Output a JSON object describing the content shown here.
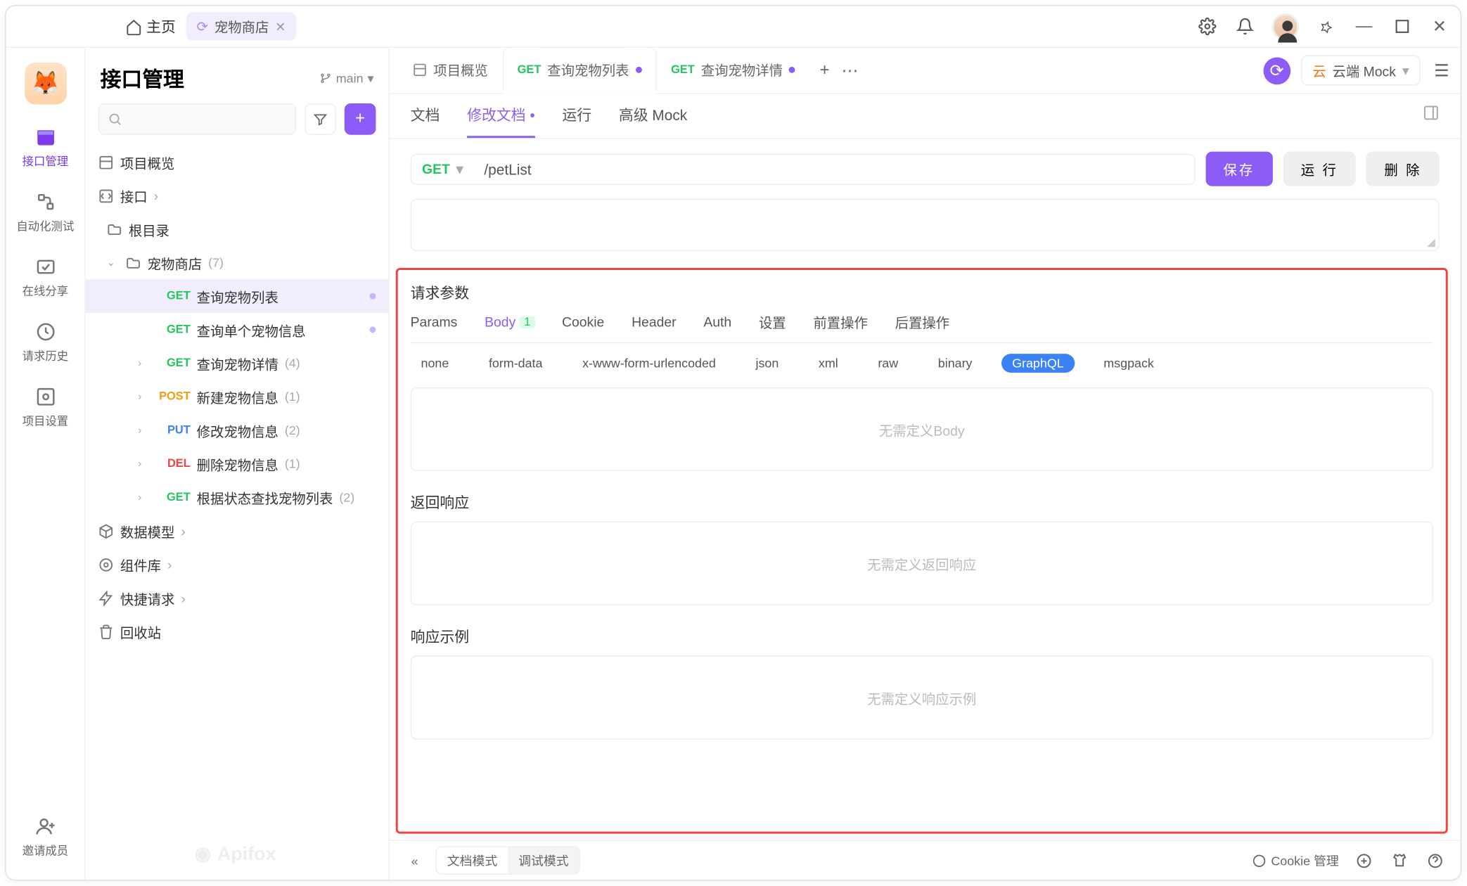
{
  "top": {
    "home": "主页",
    "tab_name": "宠物商店"
  },
  "rail": [
    {
      "label": "接口管理",
      "active": true
    },
    {
      "label": "自动化测试"
    },
    {
      "label": "在线分享"
    },
    {
      "label": "请求历史"
    },
    {
      "label": "项目设置"
    },
    {
      "label": "邀请成员"
    }
  ],
  "sidebar": {
    "title": "接口管理",
    "branch": "main",
    "overview": "项目概览",
    "api_group": "接口",
    "root_folder": "根目录",
    "folder_name": "宠物商店",
    "folder_count": "(7)",
    "endpoints": [
      {
        "method": "GET",
        "name": "查询宠物列表",
        "active": true,
        "dot": true
      },
      {
        "method": "GET",
        "name": "查询单个宠物信息",
        "dot": true
      },
      {
        "method": "GET",
        "name": "查询宠物详情",
        "count": "(4)",
        "expand": true
      },
      {
        "method": "POST",
        "name": "新建宠物信息",
        "count": "(1)",
        "expand": true
      },
      {
        "method": "PUT",
        "name": "修改宠物信息",
        "count": "(2)",
        "expand": true
      },
      {
        "method": "DEL",
        "name": "删除宠物信息",
        "count": "(1)",
        "expand": true
      },
      {
        "method": "GET",
        "name": "根据状态查找宠物列表",
        "count": "(2)",
        "expand": true
      }
    ],
    "data_model": "数据模型",
    "component_lib": "组件库",
    "quick_request": "快捷请求",
    "recycle": "回收站",
    "watermark": "Apifox"
  },
  "tabs": [
    {
      "label": "项目概览",
      "method": ""
    },
    {
      "label": "查询宠物列表",
      "method": "GET",
      "active": true,
      "modified": true
    },
    {
      "label": "查询宠物详情",
      "method": "GET",
      "modified": true
    }
  ],
  "mock_btn": "云端 Mock",
  "subtabs": [
    "文档",
    "修改文档",
    "运行",
    "高级 Mock"
  ],
  "subtab_active_idx": 1,
  "editor": {
    "method": "GET",
    "path": "/petList",
    "save": "保存",
    "run": "运 行",
    "delete": "删 除"
  },
  "sections": {
    "request": "请求参数",
    "response": "返回响应",
    "example": "响应示例",
    "empty_body": "无需定义Body",
    "empty_resp": "无需定义返回响应",
    "empty_example": "无需定义响应示例"
  },
  "param_tabs": [
    "Params",
    "Body",
    "Cookie",
    "Header",
    "Auth",
    "设置",
    "前置操作",
    "后置操作"
  ],
  "body_badge": "1",
  "body_types": [
    "none",
    "form-data",
    "x-www-form-urlencoded",
    "json",
    "xml",
    "raw",
    "binary",
    "GraphQL",
    "msgpack"
  ],
  "body_type_active": "GraphQL",
  "footer": {
    "mode_doc": "文档模式",
    "mode_debug": "调试模式",
    "cookie": "Cookie 管理"
  }
}
